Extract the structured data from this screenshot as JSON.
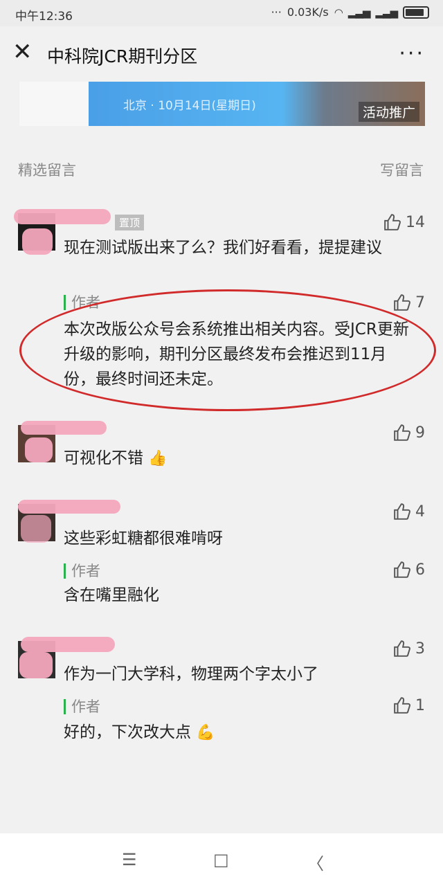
{
  "status": {
    "time": "中午12:36",
    "network_speed": "0.03K/s"
  },
  "nav": {
    "title": "中科院JCR期刊分区"
  },
  "banner": {
    "place_date": "北京 · 10月14日(星期日)",
    "tag": "活动推广"
  },
  "section": {
    "left": "精选留言",
    "right": "写留言"
  },
  "comments": [
    {
      "badge": "置顶",
      "text": "现在测试版出来了么？我们好看看，提提建议",
      "likes": "14",
      "reply": {
        "label": "作者",
        "likes": "7",
        "text": "本次改版公众号会系统推出相关内容。受JCR更新升级的影响，期刊分区最终发布会推迟到11月份，最终时间还未定。"
      }
    },
    {
      "text": "可视化不错",
      "likes": "9",
      "emoji": "👍"
    },
    {
      "text": "这些彩虹糖都很难啃呀",
      "likes": "4",
      "reply": {
        "label": "作者",
        "likes": "6",
        "text": "含在嘴里融化"
      }
    },
    {
      "text": "作为一门大学科，物理两个字太小了",
      "likes": "3",
      "reply": {
        "label": "作者",
        "likes": "1",
        "text": "好的，下次改大点",
        "emoji": "💪"
      }
    }
  ],
  "bottom_nav": {
    "menu": "☰",
    "home": "□",
    "back": "〈"
  }
}
